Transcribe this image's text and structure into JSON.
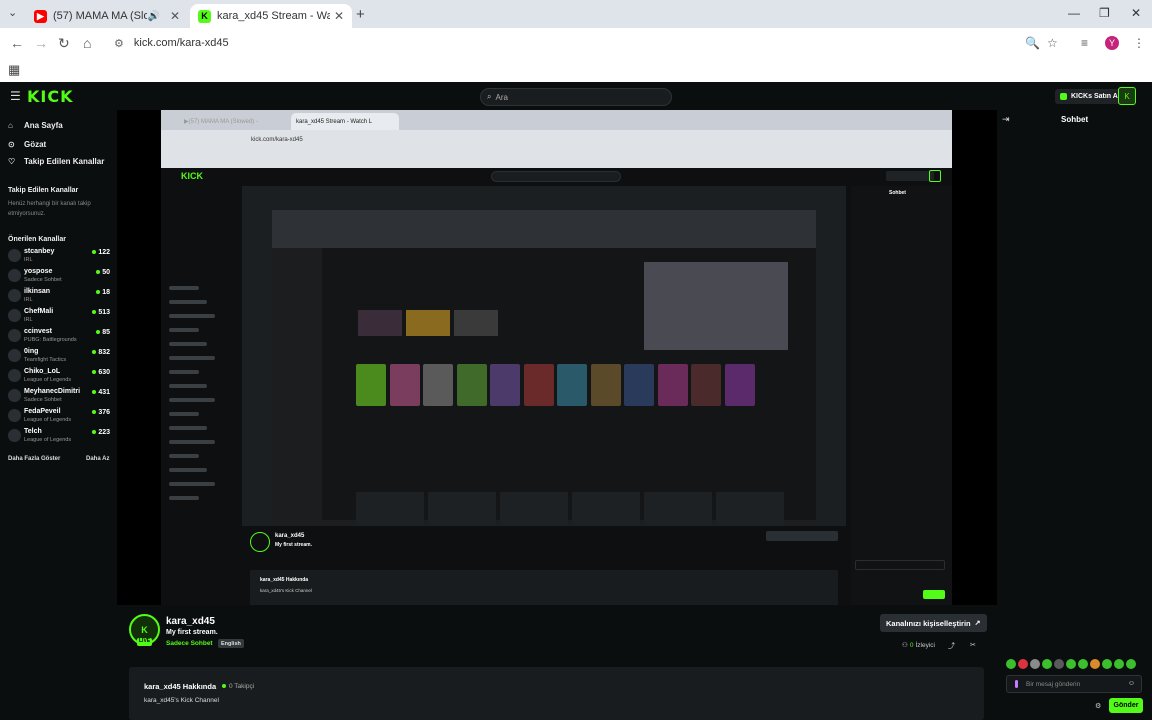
{
  "browser": {
    "tabs": [
      {
        "title": "(57) MAMA MA (Slowed) -",
        "favicon": "youtube-icon",
        "active": false
      },
      {
        "title": "kara_xd45 Stream - Watch L",
        "favicon": "kick-icon",
        "active": true
      }
    ],
    "url": "kick.com/kara-xd45",
    "profile_initial": "Y"
  },
  "header": {
    "logo": "KICK",
    "search_placeholder": "Ara",
    "kicks_button": "KICKs Satın Al"
  },
  "sidebar": {
    "nav": [
      {
        "label": "Ana Sayfa",
        "icon": "home-icon"
      },
      {
        "label": "Gözat",
        "icon": "compass-icon"
      },
      {
        "label": "Takip Edilen Kanallar",
        "icon": "heart-icon"
      }
    ],
    "followed_title": "Takip Edilen Kanallar",
    "followed_empty": "Henüz herhangi bir kanalı takip etmiyorsunuz.",
    "recommended_title": "Önerilen Kanallar",
    "channels": [
      {
        "name": "stcanbey",
        "category": "IRL",
        "viewers": "122"
      },
      {
        "name": "yospose",
        "category": "Sadece Sohbet",
        "viewers": "50"
      },
      {
        "name": "ilkinsan",
        "category": "IRL",
        "viewers": "18"
      },
      {
        "name": "ChefMali",
        "category": "IRL",
        "viewers": "513"
      },
      {
        "name": "ccinvest",
        "category": "PUBG: Battlegrounds",
        "viewers": "85"
      },
      {
        "name": "0ing",
        "category": "Teamfight Tactics",
        "viewers": "832"
      },
      {
        "name": "Chiko_LoL",
        "category": "League of Legends",
        "viewers": "630"
      },
      {
        "name": "MeyhanecDimitri",
        "category": "Sadece Sohbet",
        "viewers": "431"
      },
      {
        "name": "FedaPeveil",
        "category": "League of Legends",
        "viewers": "376"
      },
      {
        "name": "Telch",
        "category": "League of Legends",
        "viewers": "223"
      }
    ],
    "show_more": "Daha Fazla Göster",
    "show_less": "Daha Az"
  },
  "stream": {
    "streamer": "kara_xd45",
    "title": "My first stream.",
    "category": "Sadece Sohbet",
    "language": "English",
    "live_badge": "LIVE",
    "customize_button": "Kanalınızı kişiselleştirin",
    "follow_label": "İzleyici",
    "follow_count": "0"
  },
  "about": {
    "title": "kara_xd45 Hakkında",
    "followers": "0 Takipçi",
    "description": "kara_xd45's Kick Channel"
  },
  "chat": {
    "title": "Sohbet",
    "input_placeholder": "Bir mesaj gönderin",
    "send_button": "Gönder"
  },
  "colors": {
    "brand": "#53fc18",
    "background": "#0b0e0f"
  }
}
